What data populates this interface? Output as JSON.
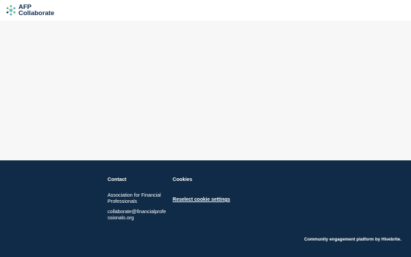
{
  "header": {
    "logo_line1": "AFP",
    "logo_line2": "Collaborate",
    "logo_icon": "afp-network-logo-icon"
  },
  "footer": {
    "contact": {
      "title": "Contact",
      "organization": "Association for Financial Professionals",
      "email": "collaborate@financialprofessionals.org"
    },
    "cookies": {
      "title": "Cookies",
      "link": "Reselect cookie settings"
    },
    "powered_by": "Community engagement platform by Hivebrite."
  },
  "colors": {
    "footer_bg": "#0f2b47",
    "brand_navy": "#0d2b4e",
    "logo_teal": "#2aa6b8",
    "logo_green": "#4caf50",
    "page_bg": "#f8f7f7"
  }
}
